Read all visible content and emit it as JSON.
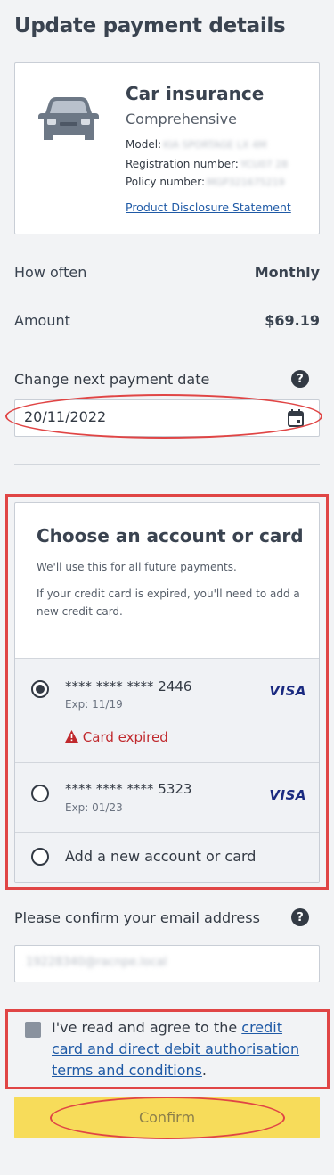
{
  "page": {
    "title": "Update payment details"
  },
  "policy": {
    "name": "Car insurance",
    "cover": "Comprehensive",
    "model_label": "Model:",
    "model_value": "KIA SPORTAGE LX 4M",
    "rego_label": "Registration number:",
    "rego_value": "YCU07 28",
    "policy_label": "Policy number:",
    "policy_value": "MGP321675219",
    "pds_link": "Product Disclosure Statement"
  },
  "summary": {
    "how_often_label": "How often",
    "how_often_value": "Monthly",
    "amount_label": "Amount",
    "amount_value": "$69.19"
  },
  "next_payment": {
    "label": "Change next payment date",
    "help": "?",
    "date_value": "20/11/2022"
  },
  "choose": {
    "title": "Choose an account or card",
    "text1": "We'll use this for all future payments.",
    "text2": "If your credit card is expired, you'll need to add a new credit card.",
    "cards": [
      {
        "number": "**** **** **** 2446",
        "exp": "Exp: 11/19",
        "brand": "VISA",
        "status": "Card expired",
        "selected": true
      },
      {
        "number": "**** **** **** 5323",
        "exp": "Exp: 01/23",
        "brand": "VISA",
        "selected": false
      }
    ],
    "add_label": "Add a new account or card"
  },
  "email": {
    "label": "Please confirm your email address",
    "help": "?",
    "value": "19228340@racnpe.local"
  },
  "agree": {
    "prefix": "I've read and agree to the ",
    "link": "credit card and direct debit authorisation terms and conditions",
    "suffix": "."
  },
  "confirm_label": "Confirm",
  "colors": {
    "annotation": "#e04545",
    "confirm_bg": "#f7dc5a",
    "link": "#1f5aa6",
    "error": "#c0292d"
  }
}
